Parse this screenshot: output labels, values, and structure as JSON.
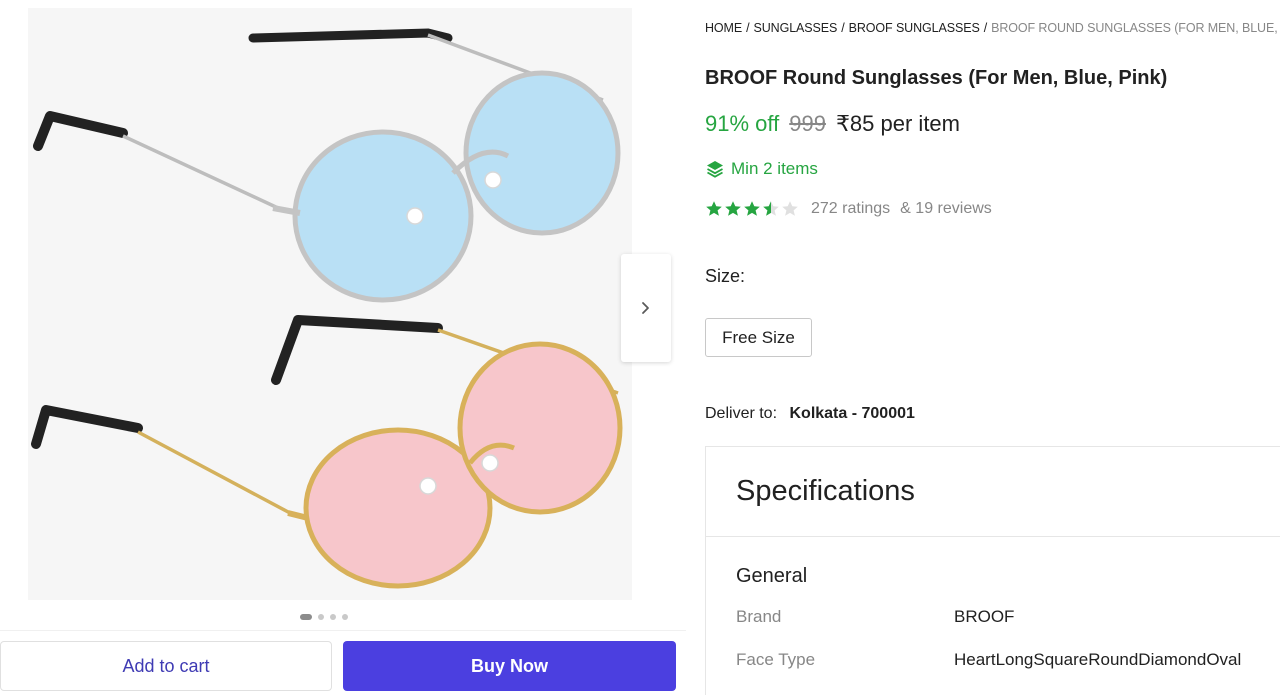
{
  "gallery": {
    "image_alt": "BROOF Round Sunglasses (For Men, Blue, Pink)",
    "dot_count": 4,
    "active_dot": 0
  },
  "actions": {
    "add_to_cart": "Add to cart",
    "buy_now": "Buy Now"
  },
  "breadcrumb": [
    {
      "label": "HOME"
    },
    {
      "label": "SUNGLASSES"
    },
    {
      "label": "BROOF SUNGLASSES"
    },
    {
      "label": "BROOF ROUND SUNGLASSES (FOR MEN, BLUE, PINK)"
    }
  ],
  "product": {
    "title": "BROOF Round Sunglasses (For Men, Blue, Pink)",
    "discount": "91% off",
    "mrp": "999",
    "price": "₹85 per item",
    "min_items": "Min 2 items",
    "rating_value": 3.5,
    "ratings_count": "272 ratings",
    "reviews_count": "& 19 reviews"
  },
  "size": {
    "label": "Size:",
    "selected": "Free Size"
  },
  "delivery": {
    "label": "Deliver to:",
    "location": "Kolkata - 700001"
  },
  "specifications": {
    "title": "Specifications",
    "group": "General",
    "rows": [
      {
        "key": "Brand",
        "value": "BROOF"
      },
      {
        "key": "Face Type",
        "value": "HeartLongSquareRoundDiamondOval"
      }
    ]
  },
  "colors": {
    "accent_green": "#26a541",
    "buy_button": "#4b3fe0",
    "cart_text": "#3f3bb4",
    "lens_blue": "#b9e0f5",
    "lens_pink": "#f7c6cb"
  },
  "icons": {
    "next": "chevron-right-icon",
    "min_items": "layers-icon",
    "star": "star-icon"
  }
}
